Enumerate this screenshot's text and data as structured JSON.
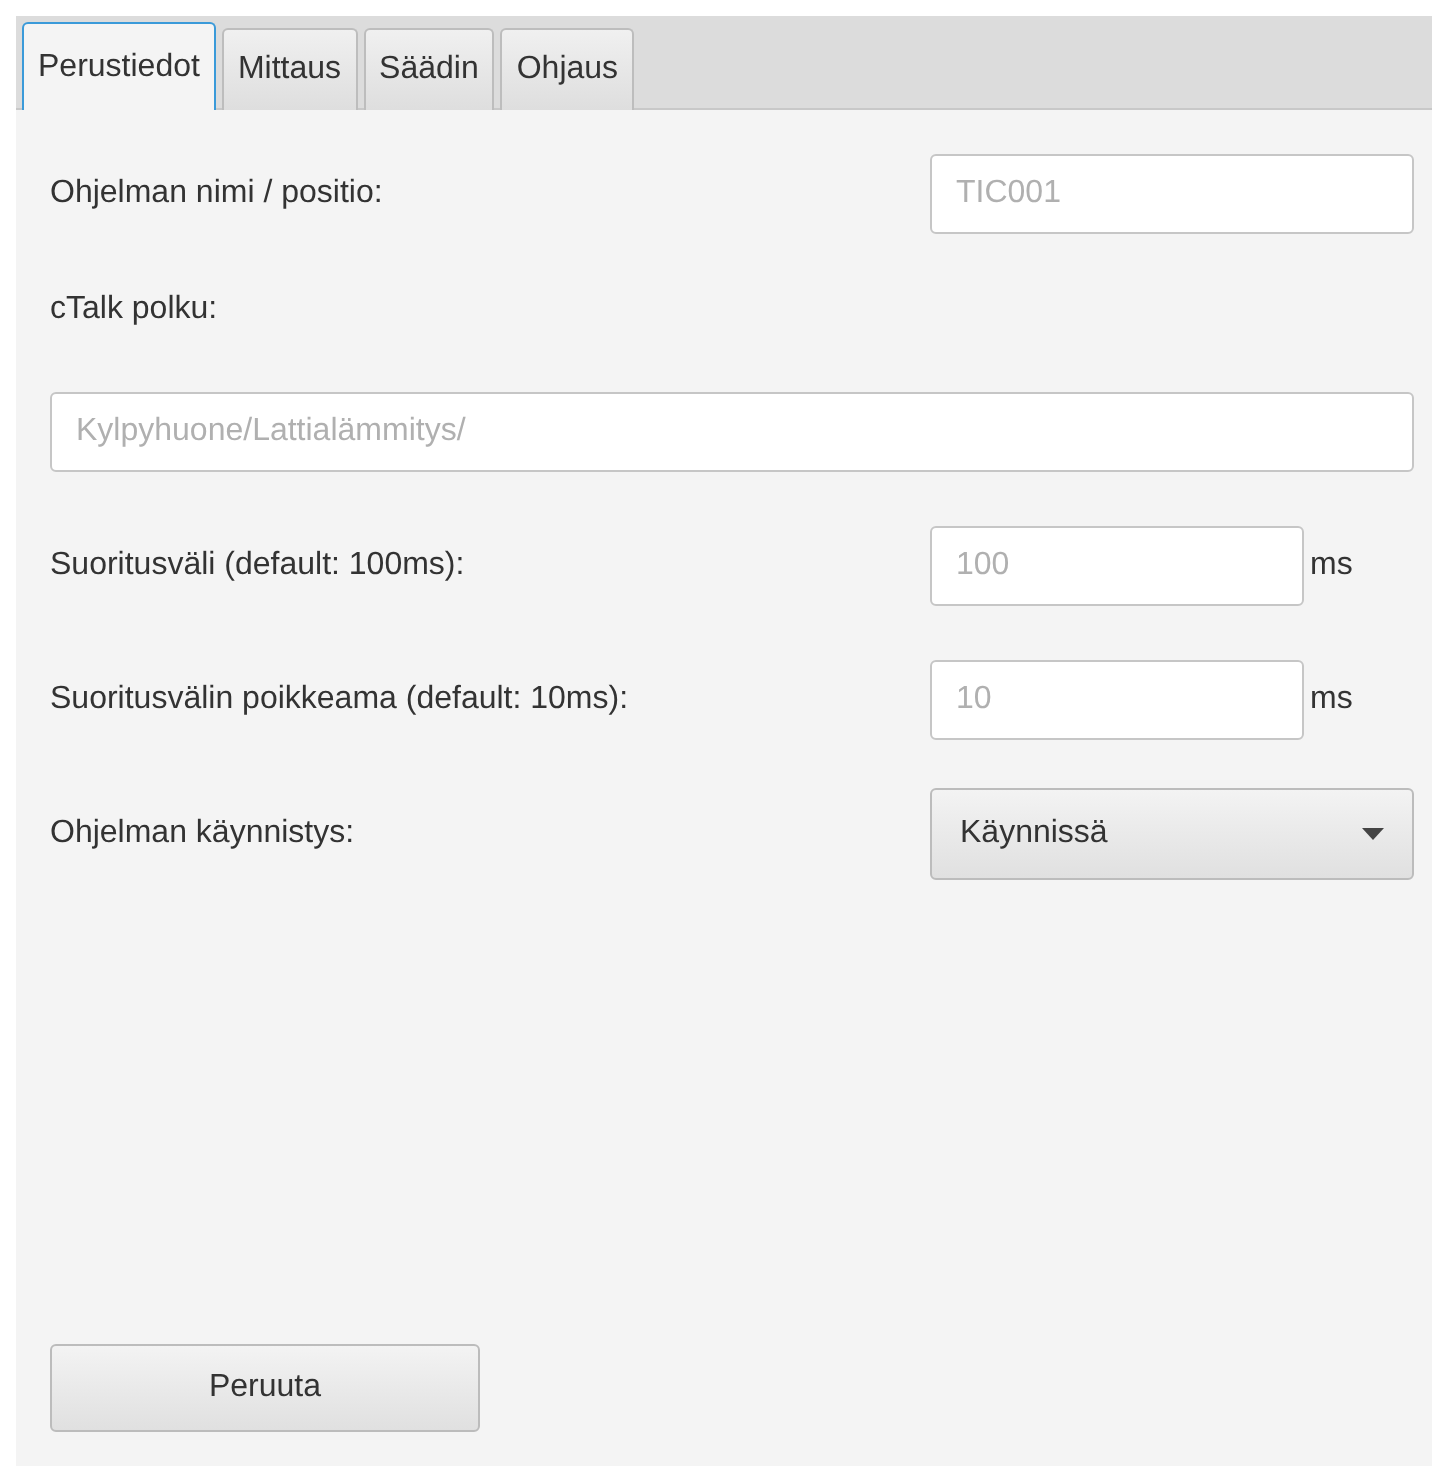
{
  "tabs": [
    {
      "label": "Perustiedot",
      "selected": true
    },
    {
      "label": "Mittaus",
      "selected": false
    },
    {
      "label": "Säädin",
      "selected": false
    },
    {
      "label": "Ohjaus",
      "selected": false
    }
  ],
  "rows": [
    {
      "kind": "text",
      "label": "Ohjelman nimi / positio:",
      "placeholder": "TIC001"
    },
    {
      "kind": "wide",
      "label": "cTalk polku:",
      "placeholder": "Kylpyhuone/Lattialämmitys/"
    },
    {
      "kind": "unit",
      "label": "Suoritusväli (default: 100ms):",
      "placeholder": "100",
      "unit": "ms"
    },
    {
      "kind": "unit",
      "label": "Suoritusvälin poikkeama (default: 10ms):",
      "placeholder": "10",
      "unit": "ms"
    },
    {
      "kind": "select",
      "label": "Ohjelman käynnistys:",
      "value": "Käynnissä"
    }
  ],
  "buttons": [
    "Peruuta"
  ]
}
